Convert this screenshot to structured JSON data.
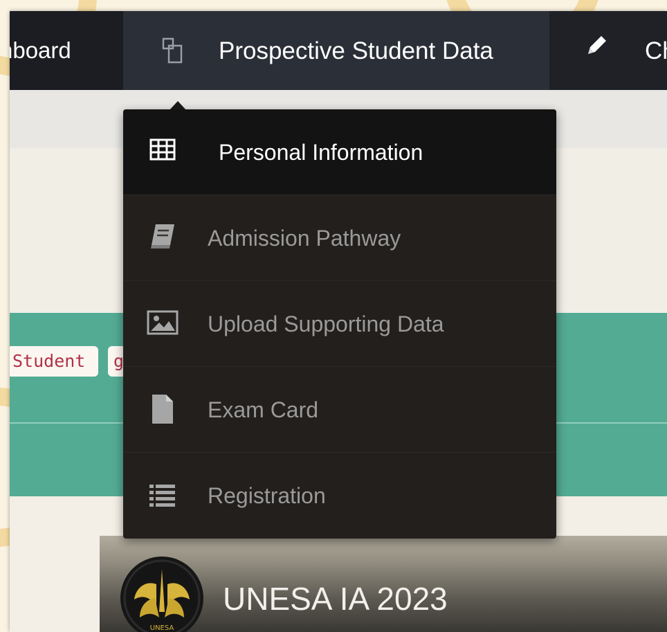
{
  "navbar": {
    "dashboard_label": "nboard",
    "prospective_label": "Prospective Student Data",
    "change_label": "Ch",
    "prospective_icon": "copy-icon",
    "change_icon": "pencil-icon"
  },
  "dropdown": {
    "items": [
      {
        "label": "Personal Information",
        "icon": "table-grid-icon",
        "active": true
      },
      {
        "label": "Admission Pathway",
        "icon": "book-icon",
        "active": false
      },
      {
        "label": "Upload Supporting Data",
        "icon": "image-icon",
        "active": false
      },
      {
        "label": "Exam Card",
        "icon": "file-icon",
        "active": false
      },
      {
        "label": "Registration",
        "icon": "list-icon",
        "active": false
      }
    ]
  },
  "content": {
    "code_pills": [
      "Student",
      "g"
    ]
  },
  "brand": {
    "title": "UNESA IA 2023",
    "logo_text": "UNESA"
  },
  "colors": {
    "navbar": "#1f2127",
    "nav_active": "#2b2f38",
    "dropdown": "#221f1d",
    "teal": "#53ab93"
  }
}
